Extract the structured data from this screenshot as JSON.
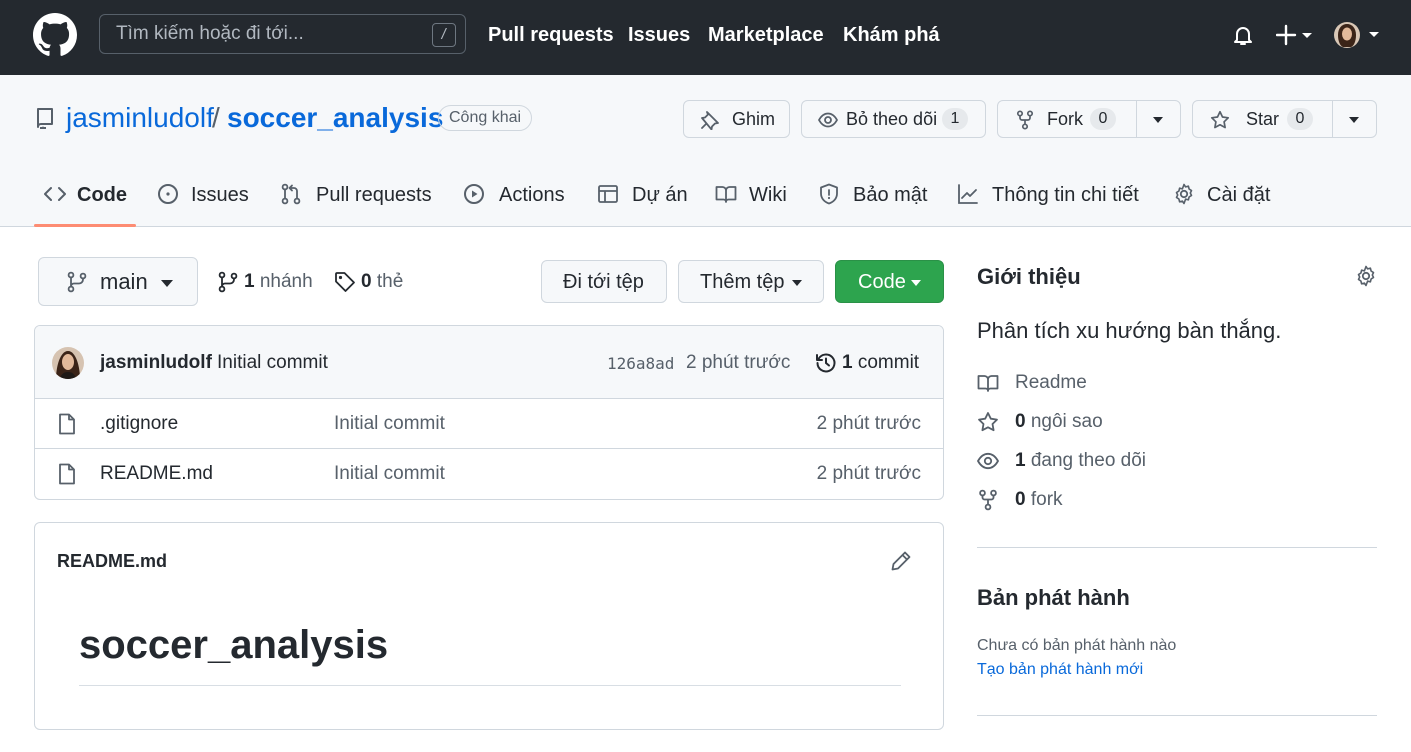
{
  "header": {
    "search_placeholder": "Tìm kiếm hoặc đi tới...",
    "search_shortcut": "/",
    "nav": [
      "Pull requests",
      "Issues",
      "Marketplace",
      "Khám phá"
    ]
  },
  "repo": {
    "owner": "jasminludolf",
    "separator": "/",
    "name": "soccer_analysis",
    "visibility": "Công khai",
    "actions": {
      "pin": "Ghim",
      "watch": "Bỏ theo dõi",
      "watch_count": "1",
      "fork": "Fork",
      "fork_count": "0",
      "star": "Star",
      "star_count": "0"
    },
    "tabs": [
      "Code",
      "Issues",
      "Pull requests",
      "Actions",
      "Dự án",
      "Wiki",
      "Bảo mật",
      "Thông tin chi tiết",
      "Cài đặt"
    ],
    "active_tab": "Code"
  },
  "filenav": {
    "branch": "main",
    "branch_count": "1",
    "branch_label": "nhánh",
    "tag_count": "0",
    "tag_label": "thẻ",
    "goto_file": "Đi tới tệp",
    "add_file": "Thêm tệp",
    "code": "Code"
  },
  "latest_commit": {
    "author": "jasminludolf",
    "message": "Initial commit",
    "sha": "126a8ad",
    "time": "2 phút trước",
    "count": "1",
    "count_label": "commit"
  },
  "files": [
    {
      "name": ".gitignore",
      "message": "Initial commit",
      "time": "2 phút trước"
    },
    {
      "name": "README.md",
      "message": "Initial commit",
      "time": "2 phút trước"
    }
  ],
  "readme": {
    "filename": "README.md",
    "heading": "soccer_analysis"
  },
  "sidebar": {
    "about_title": "Giới thiệu",
    "description": "Phân tích xu hướng bàn thắng.",
    "readme": "Readme",
    "stars_count": "0",
    "stars_label": "ngôi sao",
    "watching_count": "1",
    "watching_label": "đang theo dõi",
    "forks_count": "0",
    "forks_label": "fork",
    "releases_title": "Bản phát hành",
    "releases_none": "Chưa có bản phát hành nào",
    "releases_create": "Tạo bản phát hành mới"
  },
  "colors": {
    "header_bg": "#24292f",
    "link_blue": "#0969da",
    "green": "#2da44e",
    "tab_underline": "#fd8c73"
  }
}
